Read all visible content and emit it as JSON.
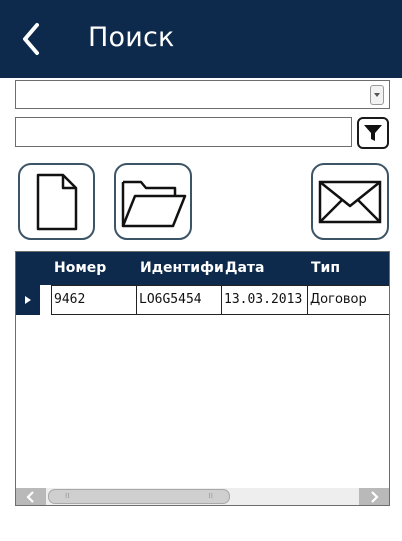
{
  "header": {
    "back_icon": "chevron-left-icon",
    "title": "Поиск",
    "background": "#0d2a4c"
  },
  "combo": {
    "value": "",
    "arrow_icon": "dropdown-arrow-icon"
  },
  "search": {
    "value": "",
    "placeholder": "",
    "filter_icon": "filter-funnel-icon"
  },
  "actions": {
    "new_document_icon": "new-document-icon",
    "open_folder_icon": "open-folder-icon",
    "mail_icon": "envelope-icon"
  },
  "grid": {
    "columns": [
      "Номер",
      "Идентифи",
      "Дата",
      "Тип"
    ],
    "rows": [
      {
        "cells": [
          "9462",
          "LO6G5454",
          "13.03.2013",
          "Договор"
        ]
      }
    ],
    "selected_row_icon": "row-pointer-icon"
  },
  "scrollbar": {
    "left_icon": "scroll-left-icon",
    "right_icon": "scroll-right-icon"
  }
}
